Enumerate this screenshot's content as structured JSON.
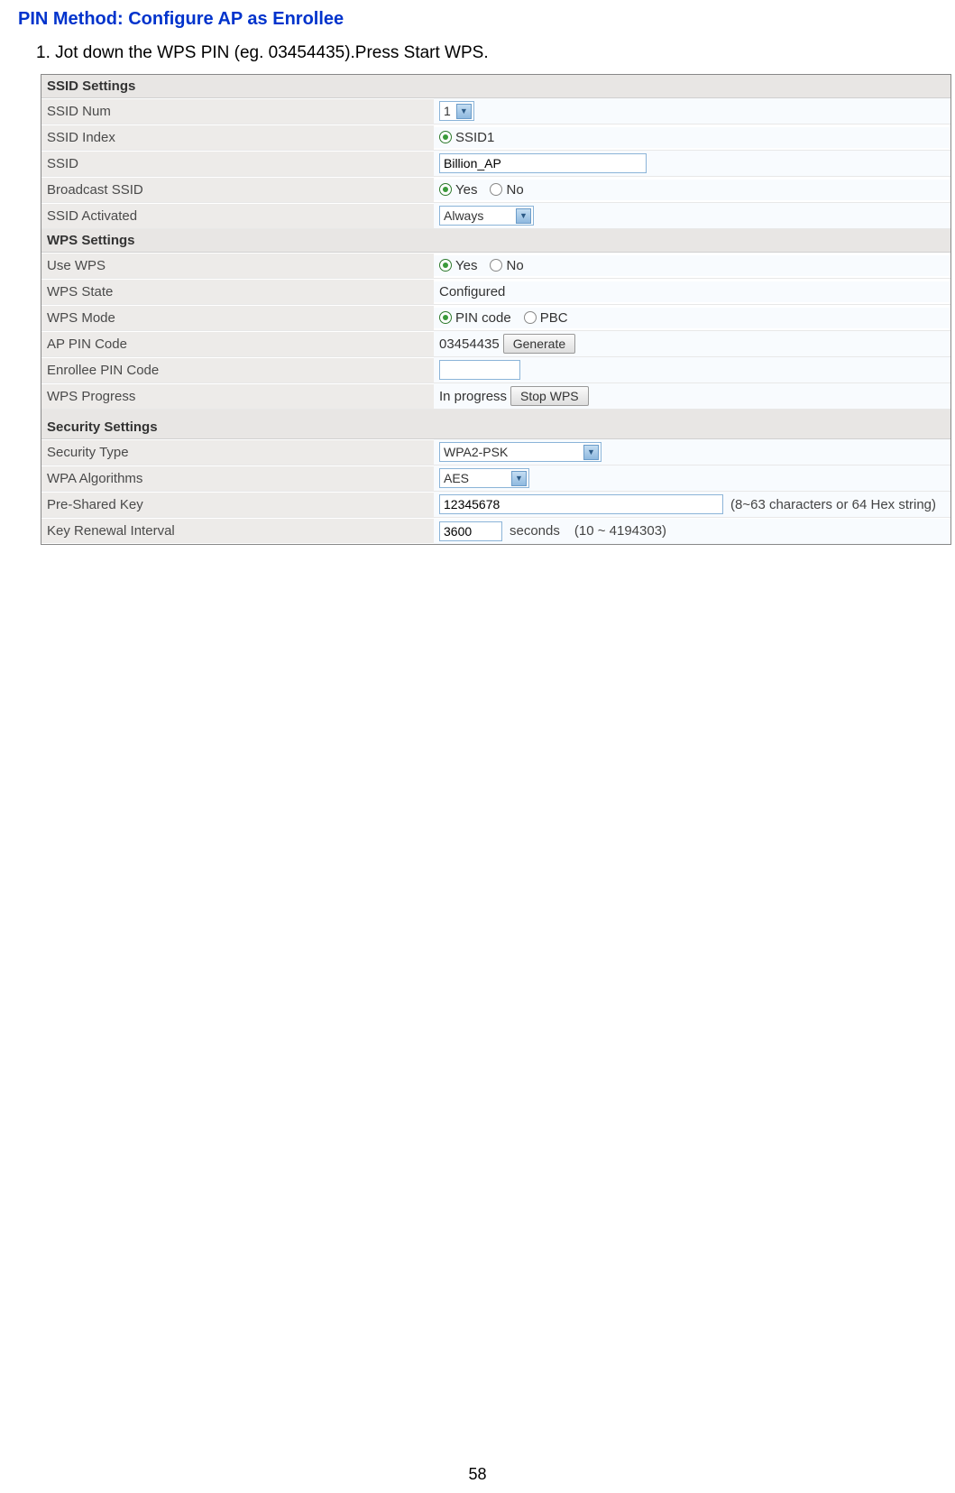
{
  "title": "PIN Method: Configure AP as Enrollee",
  "instruction": "1.  Jot down the WPS PIN (eg. 03454435).Press Start WPS.",
  "ssid_settings": {
    "header": "SSID Settings",
    "ssid_num": {
      "label": "SSID Num",
      "value": "1"
    },
    "ssid_index": {
      "label": "SSID Index",
      "option1": "SSID1"
    },
    "ssid": {
      "label": "SSID",
      "value": "Billion_AP"
    },
    "broadcast": {
      "label": "Broadcast SSID",
      "yes": "Yes",
      "no": "No"
    },
    "activated": {
      "label": "SSID Activated",
      "value": "Always"
    }
  },
  "wps_settings": {
    "header": "WPS Settings",
    "use_wps": {
      "label": "Use WPS",
      "yes": "Yes",
      "no": "No"
    },
    "wps_state": {
      "label": "WPS State",
      "value": "Configured"
    },
    "wps_mode": {
      "label": "WPS Mode",
      "pin": "PIN code",
      "pbc": "PBC"
    },
    "ap_pin": {
      "label": "AP PIN Code",
      "value": "03454435",
      "button": "Generate"
    },
    "enrollee_pin": {
      "label": "Enrollee PIN Code",
      "value": ""
    },
    "progress": {
      "label": "WPS Progress",
      "value": "In progress",
      "button": "Stop WPS"
    }
  },
  "security_settings": {
    "header": "Security Settings",
    "type": {
      "label": "Security Type",
      "value": "WPA2-PSK"
    },
    "algorithms": {
      "label": "WPA Algorithms",
      "value": "AES"
    },
    "psk": {
      "label": "Pre-Shared Key",
      "value": "12345678",
      "hint": "(8~63 characters or 64 Hex string)"
    },
    "renewal": {
      "label": "Key Renewal Interval",
      "value": "3600",
      "unit": "seconds",
      "range": "(10 ~ 4194303)"
    }
  },
  "page_number": "58"
}
